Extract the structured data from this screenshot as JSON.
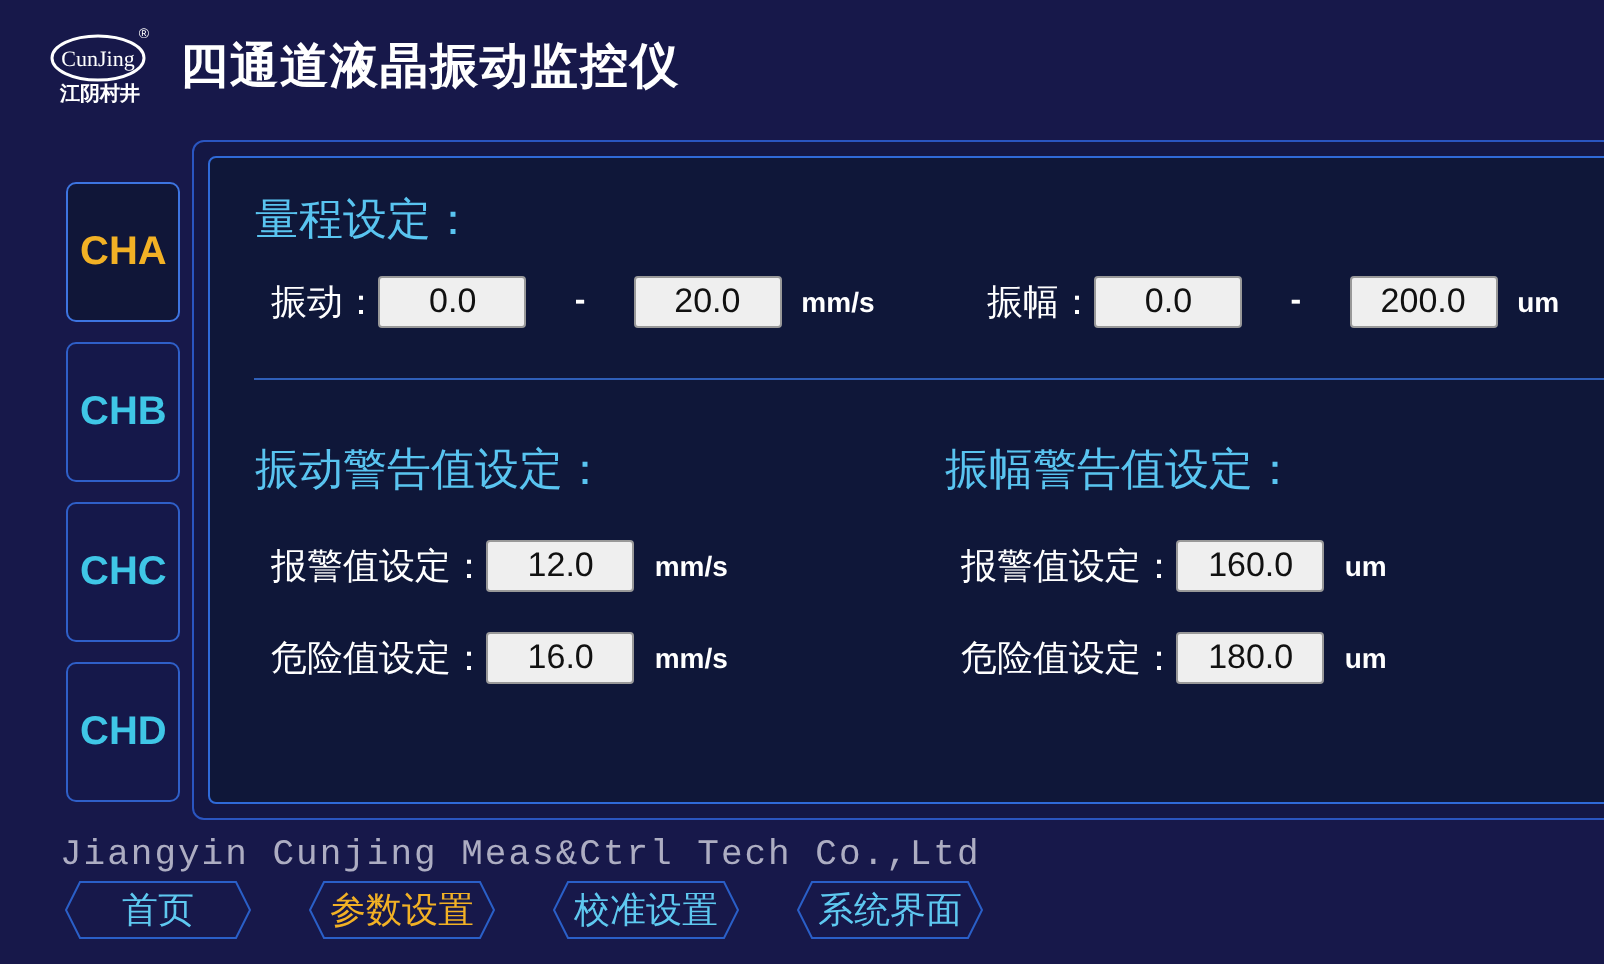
{
  "header": {
    "logo_text": "CunJing",
    "logo_mark": "®",
    "logo_subtitle": "江阴村井",
    "title": "四通道液晶振动监控仪"
  },
  "channels": [
    {
      "label": "CHA",
      "selected": true
    },
    {
      "label": "CHB",
      "selected": false
    },
    {
      "label": "CHC",
      "selected": false
    },
    {
      "label": "CHD",
      "selected": false
    }
  ],
  "range": {
    "title": "量程设定：",
    "rows": [
      {
        "label": "振动：",
        "min": "0.0",
        "separator": "-",
        "max": "20.0",
        "unit": "mm/s"
      },
      {
        "label": "振幅：",
        "min": "0.0",
        "separator": "-",
        "max": "200.0",
        "unit": "um"
      }
    ]
  },
  "alarms": [
    {
      "title": "振动警告值设定：",
      "rows": [
        {
          "label": "报警值设定：",
          "value": "12.0",
          "unit": "mm/s"
        },
        {
          "label": "危险值设定：",
          "value": "16.0",
          "unit": "mm/s"
        }
      ]
    },
    {
      "title": "振幅警告值设定：",
      "rows": [
        {
          "label": "报警值设定：",
          "value": "160.0",
          "unit": "um"
        },
        {
          "label": "危险值设定：",
          "value": "180.0",
          "unit": "um"
        }
      ]
    }
  ],
  "company": "Jiangyin Cunjing Meas&Ctrl Tech Co.,Ltd",
  "nav": [
    {
      "label": "首页",
      "selected": false
    },
    {
      "label": "参数设置",
      "selected": true
    },
    {
      "label": "校准设置",
      "selected": false
    },
    {
      "label": "系统界面",
      "selected": false
    }
  ]
}
